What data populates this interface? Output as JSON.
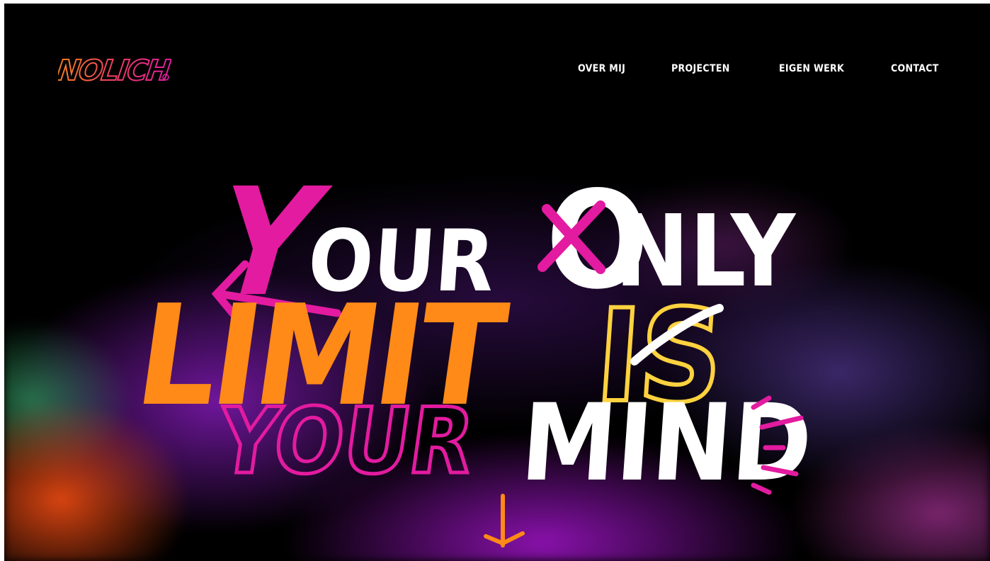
{
  "logo": {
    "text": "NOLICH",
    "colors": [
      "#f58220",
      "#e020a0"
    ]
  },
  "nav": {
    "items": [
      {
        "label": "OVER MIJ"
      },
      {
        "label": "PROJECTEN"
      },
      {
        "label": "EIGEN WERK"
      },
      {
        "label": "CONTACT"
      }
    ]
  },
  "hero": {
    "line1": {
      "first_letter": "Y",
      "word1_rest": "OUR",
      "word2_first": "O",
      "word2_rest": "NLY"
    },
    "line2": {
      "word1": "LIMIT",
      "word2": "IS"
    },
    "line3": {
      "word1": "YOUR",
      "word2": "MIND"
    }
  },
  "scroll_down": {
    "icon": "arrow-down-icon"
  },
  "colors": {
    "background": "#000000",
    "pink": "#e31ba0",
    "orange": "#ff8a17",
    "yellow": "#ffd23f",
    "white": "#ffffff"
  }
}
